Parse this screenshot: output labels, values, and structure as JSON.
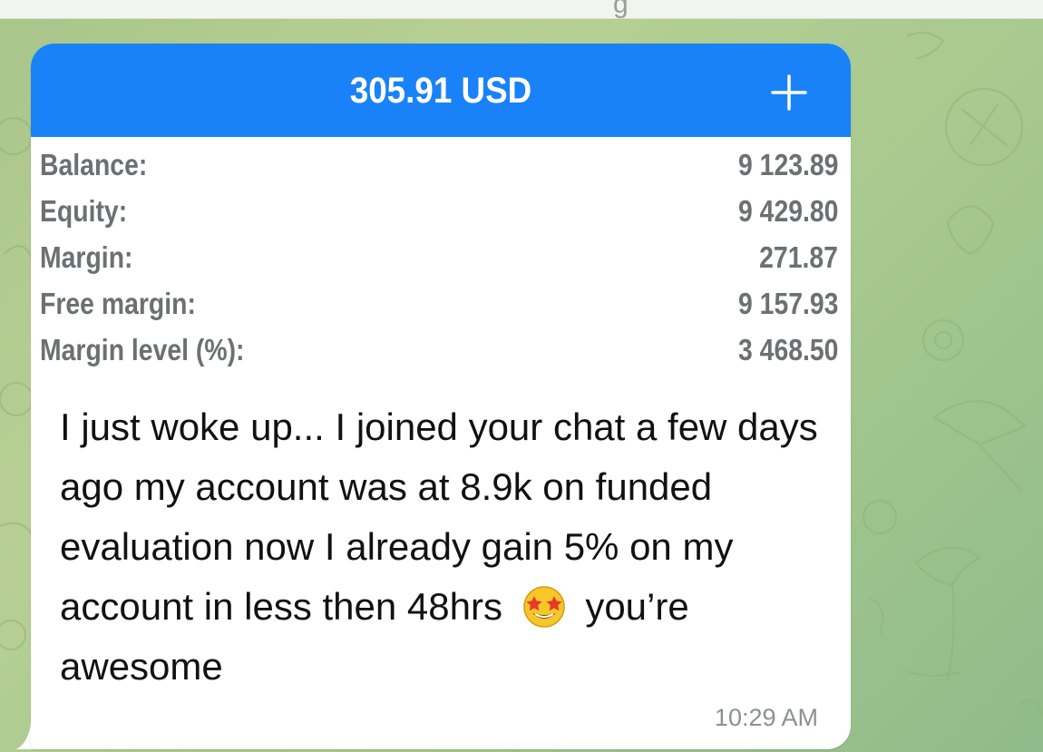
{
  "header": {
    "top_glyph": "g"
  },
  "message": {
    "account_summary": {
      "amount": "305.91 USD",
      "rows": [
        {
          "label": "Balance:",
          "value": "9 123.89"
        },
        {
          "label": "Equity:",
          "value": "9 429.80"
        },
        {
          "label": "Margin:",
          "value": "271.87"
        },
        {
          "label": "Free margin:",
          "value": "9 157.93"
        },
        {
          "label": "Margin level (%):",
          "value": "3 468.50"
        }
      ],
      "colors": {
        "header": "#1a82f8",
        "header_text": "#ffffff",
        "row_text": "#6d6f73"
      }
    },
    "text_before_emoji": "I just woke up... I joined your chat a few days ago my account was at 8.9k on funded evaluation now I already gain 5% on my account in less then 48hrs",
    "emoji_icon": "star-struck-emoji-icon",
    "text_after_emoji": "you’re awesome",
    "time": "10:29 AM"
  }
}
